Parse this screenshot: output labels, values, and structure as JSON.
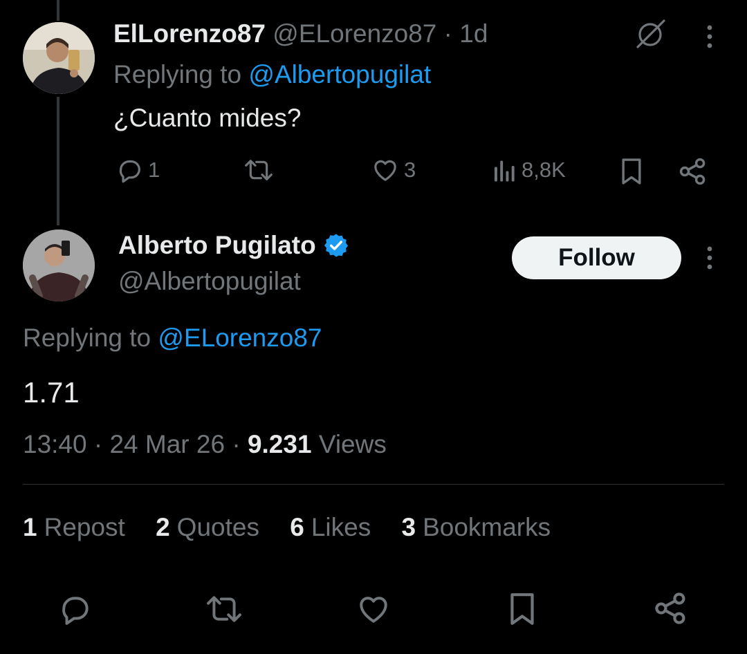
{
  "reply_tweet": {
    "display_name": "ElLorenzo87",
    "handle": "@ELorenzo87",
    "time_sep": "·",
    "time": "1d",
    "replying_prefix": "Replying to",
    "replying_handle": "@Albertopugilat",
    "text": "¿Cuanto mides?",
    "counts": {
      "replies": "1",
      "likes": "3",
      "views": "8,8K"
    }
  },
  "main_tweet": {
    "display_name": "Alberto Pugilato",
    "handle": "@Albertopugilat",
    "follow_label": "Follow",
    "replying_prefix": "Replying to",
    "replying_handle": "@ELorenzo87",
    "text": "1.71",
    "timestamp": "13:40 · 24 Mar 26 ·",
    "views_count": "9.231",
    "views_label": "Views",
    "stats": [
      {
        "count": "1",
        "label": "Repost"
      },
      {
        "count": "2",
        "label": "Quotes"
      },
      {
        "count": "6",
        "label": "Likes"
      },
      {
        "count": "3",
        "label": "Bookmarks"
      }
    ]
  },
  "colors": {
    "background": "#000000",
    "link": "#1d9bf0",
    "muted": "#71767b",
    "verified": "#1d9bf0"
  },
  "icons": [
    "reply-icon",
    "repost-icon",
    "like-icon",
    "views-icon",
    "bookmark-icon",
    "share-icon",
    "grok-icon",
    "more-icon",
    "verified-badge-icon"
  ]
}
